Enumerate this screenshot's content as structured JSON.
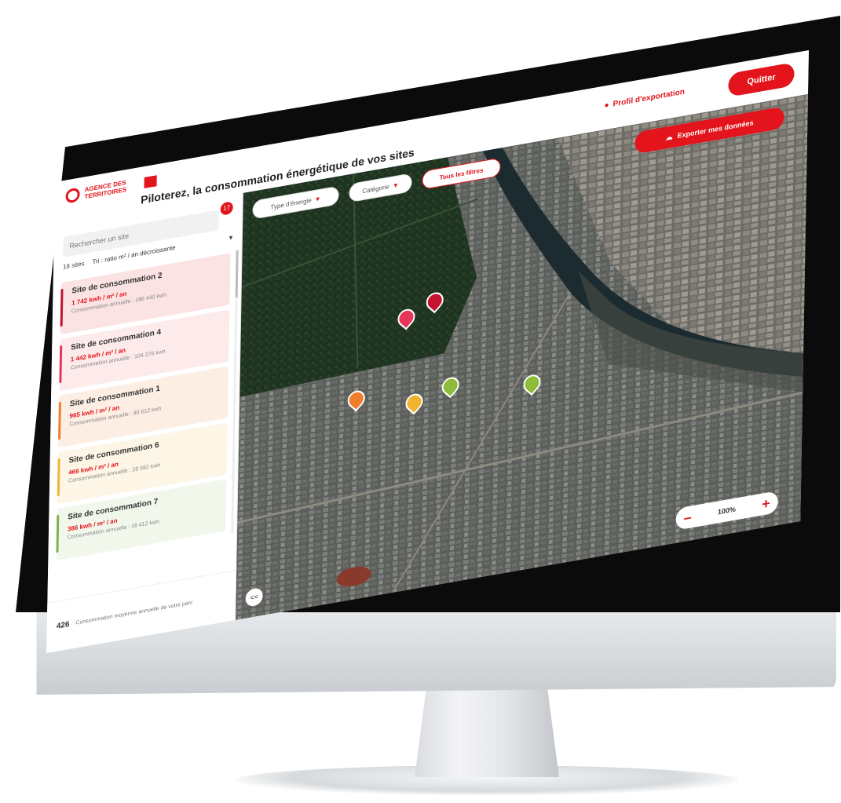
{
  "header": {
    "logo_text": "AGENCE DES TERRITOIRES",
    "profile_link": "Profil d'exportation",
    "quit_label": "Quitter",
    "page_title": "Piloterez, la consommation énergétique de vos sites"
  },
  "sidebar": {
    "search_placeholder": "Rechercher un site",
    "result_count": "17",
    "sort_label": "18 sites",
    "sort_value": "Tri : ratio m² / an décroissante",
    "sites": [
      {
        "name": "Site de consommation 2",
        "ratio": "1 742 kwh / m² / an",
        "annual": "Consommation annuelle : 196 440 kwh",
        "color": "#c4122f",
        "bg": "#fbe3e4"
      },
      {
        "name": "Site de consommation 4",
        "ratio": "1 442 kwh / m² / an",
        "annual": "Consommation annuelle : 104 276 kwh",
        "color": "#e8365a",
        "bg": "#fdeaea"
      },
      {
        "name": "Site de consommation 1",
        "ratio": "965 kwh / m² / an",
        "annual": "Consommation annuelle : 90 612 kwh",
        "color": "#ef7d2c",
        "bg": "#fdeee4"
      },
      {
        "name": "Site de consommation 6",
        "ratio": "466 kwh / m² / an",
        "annual": "Consommation annuelle : 28 592 kwh",
        "color": "#f0b430",
        "bg": "#fdf6e6"
      },
      {
        "name": "Site de consommation 7",
        "ratio": "386 kwh / m² / an",
        "annual": "Consommation annuelle : 18 412 kwh",
        "color": "#7fb24a",
        "bg": "#f2f7ec"
      }
    ],
    "footer_number": "426",
    "footer_text": "Consommation moyenne annuelle de votre parc"
  },
  "map": {
    "filter_energy": "Type d'énergie",
    "filter_category": "Catégorie",
    "filter_reset": "Tous les filtres",
    "export_label": "Exporter mes données",
    "zoom_value": "100%",
    "collapse_label": "<<",
    "pins": [
      {
        "label": "Site 2",
        "color": "#c4122f"
      },
      {
        "label": "Site 4",
        "color": "#e8365a"
      },
      {
        "label": "Site 1",
        "color": "#ef7d2c"
      },
      {
        "label": "Site 6",
        "color": "#f0b430"
      },
      {
        "label": "Site 5",
        "color": "#8dbb3a"
      },
      {
        "label": "Site 7",
        "color": "#8dbb3a"
      }
    ]
  },
  "colors": {
    "brand": "#e3141b"
  }
}
